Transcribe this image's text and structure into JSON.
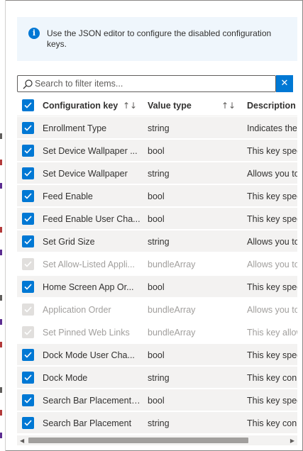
{
  "info": {
    "text": "Use the JSON editor to configure the disabled configuration keys.",
    "icon": "info-icon"
  },
  "search": {
    "placeholder": "Search to filter items...",
    "clear_symbol": "✕"
  },
  "columns": {
    "key": "Configuration key",
    "type": "Value type",
    "desc": "Description",
    "sort_symbol": "↑↓"
  },
  "rows": [
    {
      "key": "Enrollment Type",
      "type": "string",
      "desc": "Indicates the",
      "enabled": true
    },
    {
      "key": "Set Device Wallpaper ...",
      "type": "bool",
      "desc": "This key spec",
      "enabled": true
    },
    {
      "key": "Set Device Wallpaper",
      "type": "string",
      "desc": "Allows you to",
      "enabled": true
    },
    {
      "key": "Feed Enable",
      "type": "bool",
      "desc": "This key spec",
      "enabled": true
    },
    {
      "key": "Feed Enable User Cha...",
      "type": "bool",
      "desc": "This key spec",
      "enabled": true
    },
    {
      "key": "Set Grid Size",
      "type": "string",
      "desc": "Allows you to",
      "enabled": true
    },
    {
      "key": "Set Allow-Listed Appli...",
      "type": "bundleArray",
      "desc": "Allows you to",
      "enabled": false
    },
    {
      "key": "Home Screen App Or...",
      "type": "bool",
      "desc": "This key spec",
      "enabled": true
    },
    {
      "key": "Application Order",
      "type": "bundleArray",
      "desc": "Allows you to",
      "enabled": false
    },
    {
      "key": "Set Pinned Web Links",
      "type": "bundleArray",
      "desc": "This key allow",
      "enabled": false
    },
    {
      "key": "Dock Mode User Cha...",
      "type": "bool",
      "desc": "This key spec",
      "enabled": true
    },
    {
      "key": "Dock Mode",
      "type": "string",
      "desc": "This key con",
      "enabled": true
    },
    {
      "key": "Search Bar Placement ...",
      "type": "bool",
      "desc": "This key spec",
      "enabled": true
    },
    {
      "key": "Search Bar Placement",
      "type": "string",
      "desc": "This key con",
      "enabled": true
    }
  ],
  "colors": {
    "accent": "#0078d4",
    "info_bg": "#eff6fc",
    "row_bg": "#f3f2f1",
    "disabled_text": "#a19f9d"
  }
}
